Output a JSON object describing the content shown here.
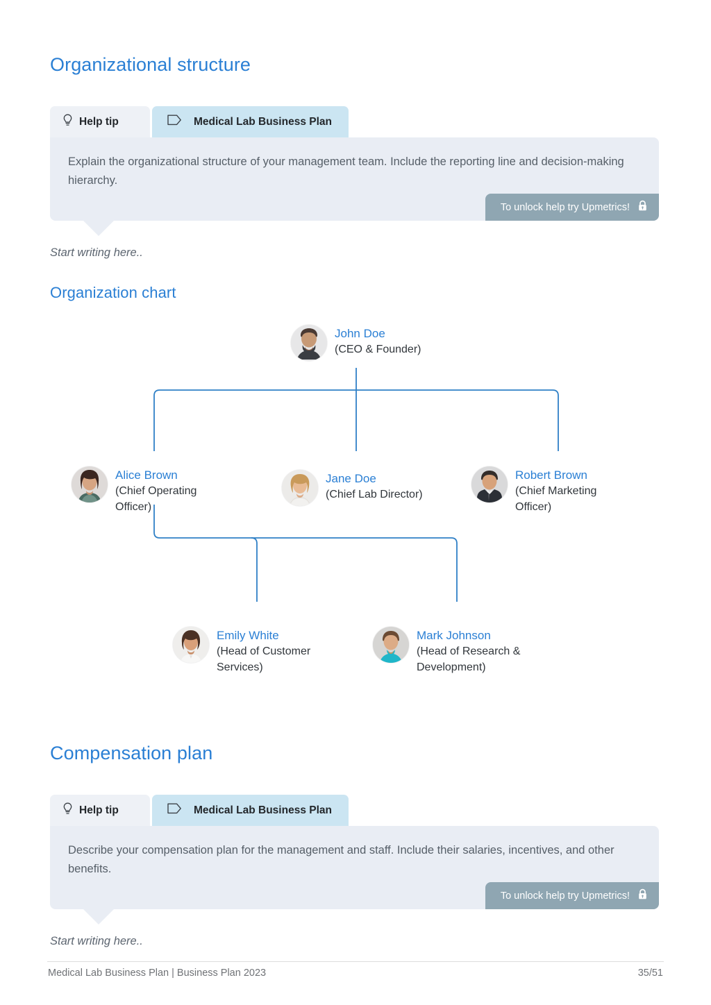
{
  "sections": {
    "org_structure": {
      "heading": "Organizational structure",
      "tabs": {
        "help_label": "Help tip",
        "help_icon": "lightbulb-icon",
        "plan_label": "Medical Lab Business Plan",
        "plan_icon": "tag-icon"
      },
      "tip_text": "Explain the organizational structure of your management team. Include the reporting line and decision-making hierarchy.",
      "unlock_label": "To unlock help try Upmetrics!",
      "unlock_icon": "lock-icon",
      "placeholder": "Start writing here.."
    },
    "org_chart": {
      "heading": "Organization chart"
    },
    "compensation": {
      "heading": "Compensation plan",
      "tabs": {
        "help_label": "Help tip",
        "help_icon": "lightbulb-icon",
        "plan_label": "Medical Lab Business Plan",
        "plan_icon": "tag-icon"
      },
      "tip_text": "Describe your compensation plan for the management and staff. Include their salaries, incentives, and other benefits.",
      "unlock_label": "To unlock help try Upmetrics!",
      "unlock_icon": "lock-icon",
      "placeholder": "Start writing here.."
    }
  },
  "chart_data": {
    "type": "diagram",
    "title": "Organization chart",
    "nodes": [
      {
        "id": "ceo",
        "name": "John Doe",
        "role": "(CEO & Founder)",
        "level": 0,
        "parent": null
      },
      {
        "id": "coo",
        "name": "Alice Brown",
        "role": "(Chief Operating Officer)",
        "level": 1,
        "parent": "ceo"
      },
      {
        "id": "cld",
        "name": "Jane Doe",
        "role": "(Chief Lab Director)",
        "level": 1,
        "parent": "ceo"
      },
      {
        "id": "cmo",
        "name": "Robert Brown",
        "role": "(Chief Marketing Officer)",
        "level": 1,
        "parent": "ceo"
      },
      {
        "id": "hcs",
        "name": "Emily White",
        "role": "(Head of Customer Services)",
        "level": 2,
        "parent": "coo"
      },
      {
        "id": "hrd",
        "name": "Mark Johnson",
        "role": "(Head of Research & Development)",
        "level": 2,
        "parent": "coo"
      }
    ],
    "node_labels": {
      "ceo_name": "John Doe",
      "ceo_role": "(CEO & Founder)",
      "coo_name": "Alice Brown",
      "coo_role_1": "(Chief Operating",
      "coo_role_2": "Officer)",
      "cld_name": "Jane Doe",
      "cld_role": "(Chief Lab Director)",
      "cmo_name": "Robert Brown",
      "cmo_role_1": "(Chief Marketing",
      "cmo_role_2": "Officer)",
      "hcs_name": "Emily White",
      "hcs_role_1": "(Head of Customer",
      "hcs_role_2": "Services)",
      "hrd_name": "Mark Johnson",
      "hrd_role_1": "(Head of Research &",
      "hrd_role_2": "Development)"
    }
  },
  "footer": {
    "left": "Medical Lab Business Plan | Business Plan 2023",
    "right": "35/51"
  },
  "colors": {
    "heading_blue": "#2a7fd4",
    "tab_plan_bg": "#cbe5f2",
    "tab_help_bg": "#eef1f6",
    "bubble_bg": "#e9edf4",
    "unlock_bg": "#8fa6b2",
    "line_blue": "#2f80c6"
  }
}
